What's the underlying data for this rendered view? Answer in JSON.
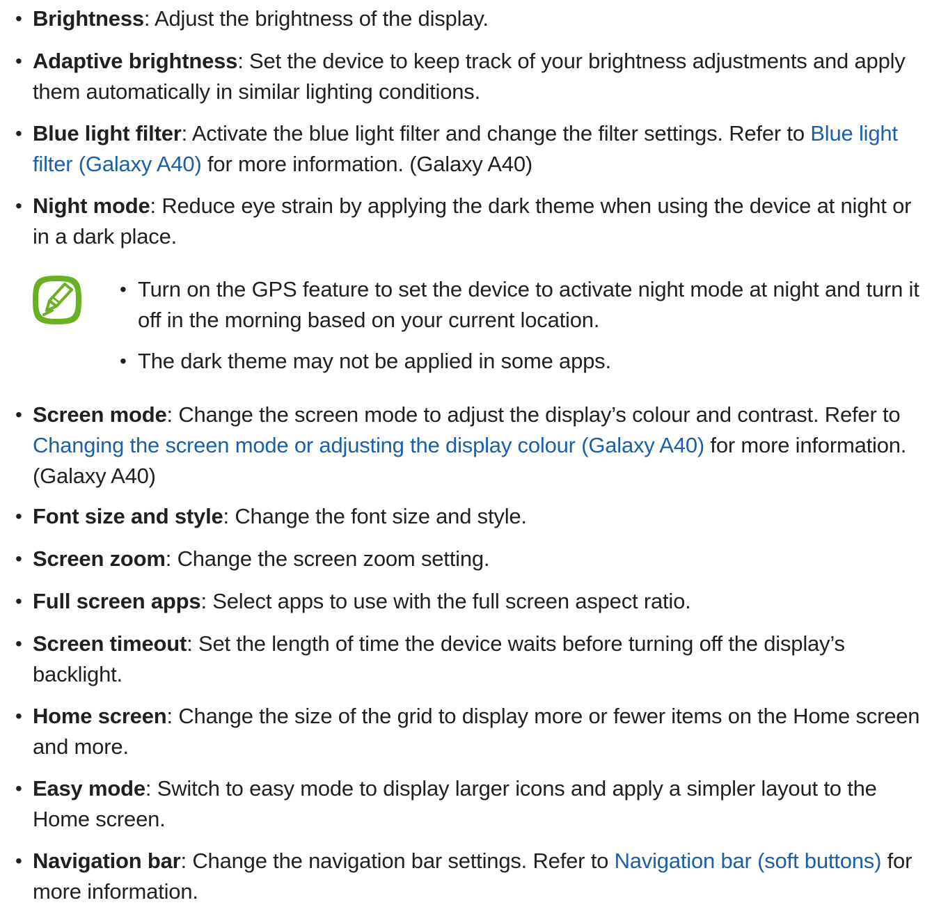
{
  "items": [
    {
      "term": "Brightness",
      "text": ": Adjust the brightness of the display."
    },
    {
      "term": "Adaptive brightness",
      "text": ": Set the device to keep track of your brightness adjustments and apply them automatically in similar lighting conditions."
    },
    {
      "term": "Blue light filter",
      "text": ": Activate the blue light filter and change the filter settings. Refer to ",
      "link": "Blue light filter (Galaxy A40)",
      "after": " for more information. (Galaxy A40)"
    },
    {
      "term": "Night mode",
      "text": ": Reduce eye strain by applying the dark theme when using the device at night or in a dark place."
    },
    {
      "term": "Screen mode",
      "text": ": Change the screen mode to adjust the display’s colour and contrast. Refer to ",
      "link": "Changing the screen mode or adjusting the display colour (Galaxy A40)",
      "after": " for more information. (Galaxy A40)"
    },
    {
      "term": "Font size and style",
      "text": ": Change the font size and style."
    },
    {
      "term": "Screen zoom",
      "text": ": Change the screen zoom setting."
    },
    {
      "term": "Full screen apps",
      "text": ": Select apps to use with the full screen aspect ratio."
    },
    {
      "term": "Screen timeout",
      "text": ": Set the length of time the device waits before turning off the display’s backlight."
    },
    {
      "term": "Home screen",
      "text": ": Change the size of the grid to display more or fewer items on the Home screen and more."
    },
    {
      "term": "Easy mode",
      "text": ": Switch to easy mode to display larger icons and apply a simpler layout to the Home screen."
    },
    {
      "term": "Navigation bar",
      "text": ": Change the navigation bar settings. Refer to ",
      "link": "Navigation bar (soft buttons)",
      "after": " for more information."
    }
  ],
  "note": {
    "icon": "note-pen-icon",
    "icon_color": "#6ab023",
    "items": [
      "Turn on the GPS feature to set the device to activate night mode at night and turn it off in the morning based on your current location.",
      "The dark theme may not be applied in some apps."
    ]
  },
  "bullet_char": "•",
  "colors": {
    "text": "#231f20",
    "link": "#1a5fa8",
    "note_icon": "#6ab023"
  }
}
